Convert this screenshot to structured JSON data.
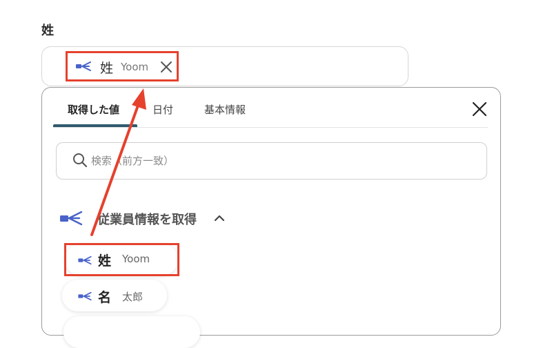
{
  "field": {
    "label": "姓",
    "chip": {
      "name": "姓",
      "value": "Yoom",
      "icon": "yoom-logo-icon",
      "remove_icon": "close-icon"
    }
  },
  "panel": {
    "tabs": [
      {
        "label": "取得した値",
        "active": true
      },
      {
        "label": "日付",
        "active": false
      },
      {
        "label": "基本情報",
        "active": false
      }
    ],
    "close_icon": "close-icon",
    "search": {
      "placeholder": "検索（前方一致）",
      "value": "",
      "icon": "search-icon"
    },
    "section": {
      "title": "従業員情報を取得",
      "icon": "yoom-logo-icon",
      "toggle_icon": "chevron-up-icon",
      "expanded": true,
      "options": [
        {
          "name": "姓",
          "value": "Yoom",
          "highlighted": true
        },
        {
          "name": "名",
          "value": "太郎",
          "highlighted": false
        }
      ]
    }
  },
  "colors": {
    "highlight": "#e5412d",
    "tab_underline": "#2e5a6d",
    "arrow": "#e5412d",
    "icon_blue": "#4a63c9"
  }
}
